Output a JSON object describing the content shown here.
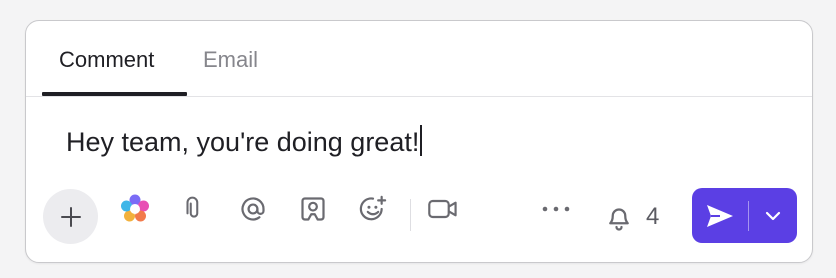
{
  "tabs": [
    {
      "label": "Comment",
      "active": true
    },
    {
      "label": "Email",
      "active": false
    }
  ],
  "editor": {
    "text": "Hey team, you're doing great!"
  },
  "toolbar": {
    "icons": [
      "plus-icon",
      "ai-sparkle-icon",
      "paperclip-icon",
      "at-mention-icon",
      "clip-image-icon",
      "emoji-add-icon",
      "video-icon",
      "more-icon"
    ],
    "notification_count": "4"
  },
  "colors": {
    "accent": "#5b3fe4",
    "text": "#1f1f24",
    "muted": "#86868c"
  }
}
